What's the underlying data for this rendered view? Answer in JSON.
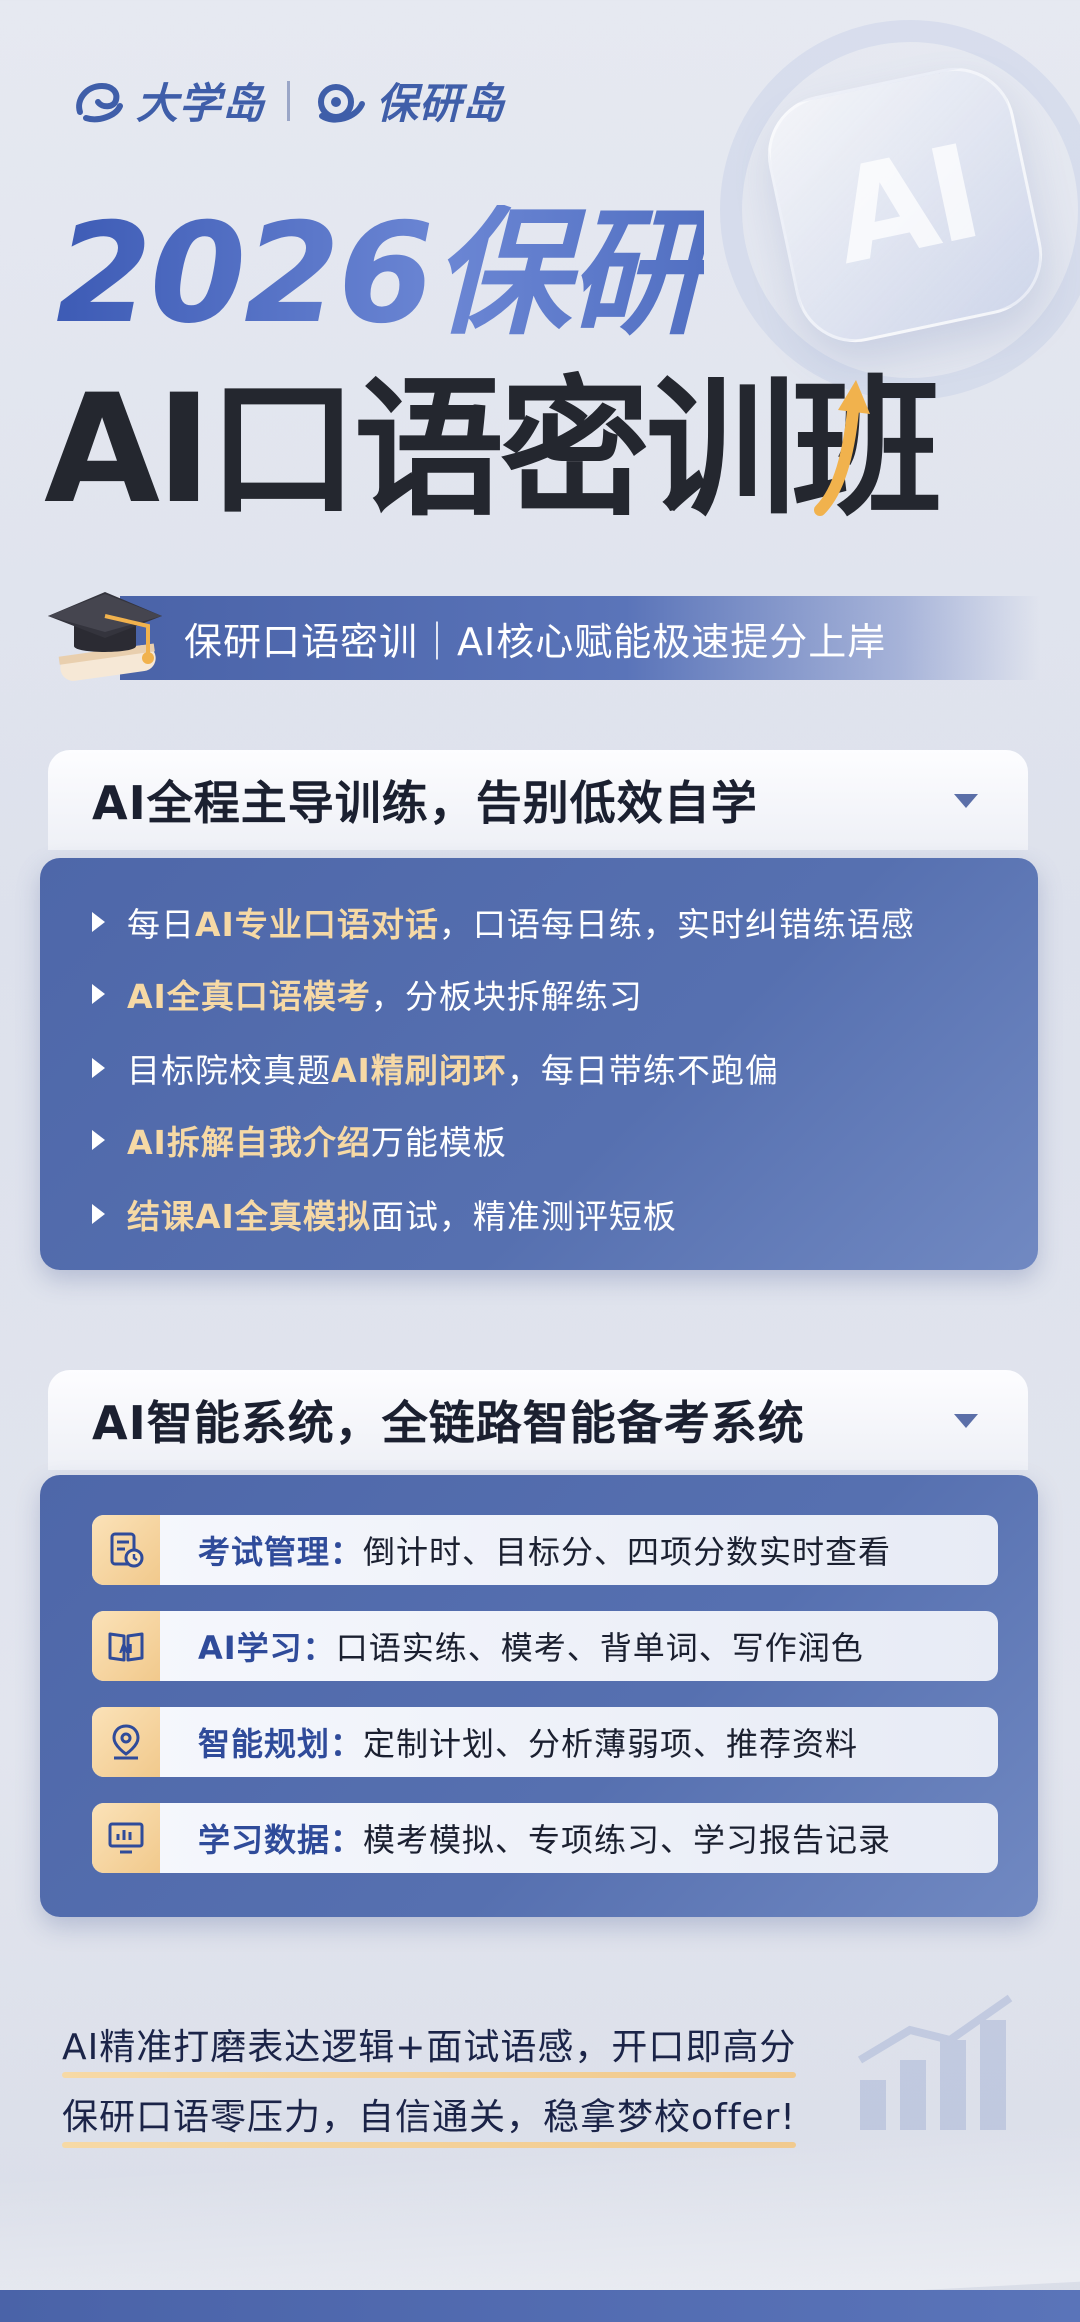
{
  "brand": {
    "logo1_text": "大学岛",
    "logo2_text": "保研岛"
  },
  "hero": {
    "year_title": "2026保研",
    "main_title": "AI口语密训班",
    "badge_text": "AI",
    "subtitle": "保研口语密训｜AI核心赋能极速提分上岸"
  },
  "section1": {
    "heading": "AI全程主导训练，告别低效自学",
    "items": [
      {
        "pre": "每日",
        "hl": "AI专业口语对话",
        "post": "，口语每日练，实时纠错练语感"
      },
      {
        "pre": "",
        "hl": "AI全真口语模考",
        "post": "，分板块拆解练习"
      },
      {
        "pre": "目标院校真题",
        "hl": "AI精刷闭环",
        "post": "，每日带练不跑偏"
      },
      {
        "pre": "",
        "hl": "AI拆解自我介绍",
        "post": "万能模板"
      },
      {
        "pre": "",
        "hl": "结课AI全真模拟",
        "post": "面试，精准测评短板"
      }
    ]
  },
  "section2": {
    "heading": "AI智能系统，全链路智能备考系统",
    "features": [
      {
        "icon": "exam-clipboard-icon",
        "key": "考试管理：",
        "value": "倒计时、目标分、四项分数实时查看"
      },
      {
        "icon": "ai-book-icon",
        "key": "AI学习：",
        "value": "口语实练、模考、背单词、写作润色"
      },
      {
        "icon": "location-pin-icon",
        "key": "智能规划：",
        "value": "定制计划、分析薄弱项、推荐资料"
      },
      {
        "icon": "monitor-chart-icon",
        "key": "学习数据：",
        "value": "模考模拟、专项练习、学习报告记录"
      }
    ]
  },
  "closing": {
    "line1": "AI精准打磨表达逻辑+面试语感，开口即高分",
    "line2": "保研口语零压力，自信通关，稳拿梦校offer!"
  },
  "colors": {
    "primary_blue": "#4e67a9",
    "highlight_gold": "#f6d9a5",
    "title_dark": "#24272f"
  }
}
